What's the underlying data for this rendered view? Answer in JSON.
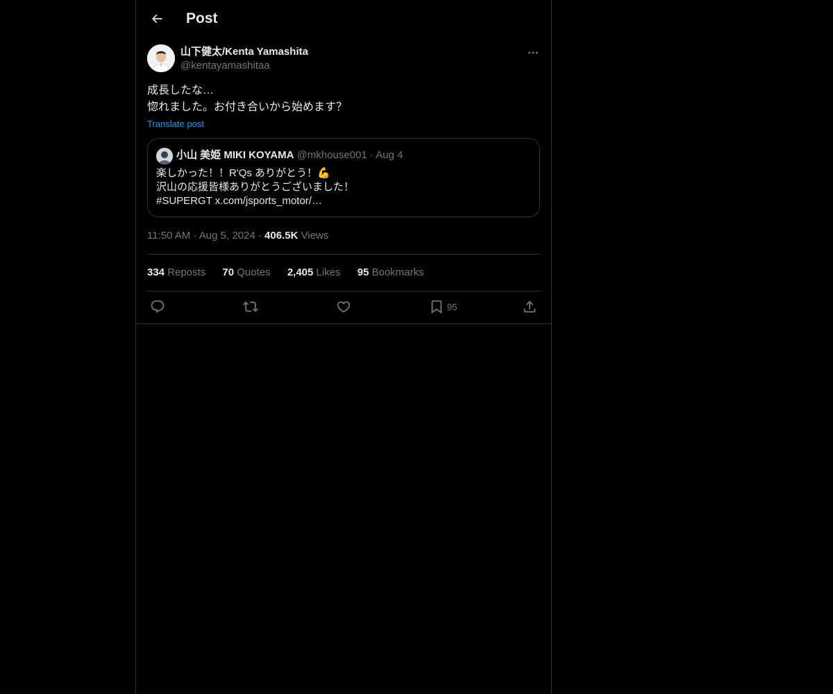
{
  "header": {
    "title": "Post",
    "back_icon": "arrow-left-icon"
  },
  "post": {
    "author_name": "山下健太/Kenta Yamashita",
    "author_handle": "@kentayamashitaa",
    "text": "成長したな…\n惚れました。お付き合いから始めます？",
    "translate_label": "Translate post",
    "timestamp": "11:50 AM",
    "date": "Aug 5, 2024",
    "views_count": "406.5K",
    "views_label": "Views"
  },
  "quote": {
    "author_name": "小山 美姫 MIKI KOYAMA",
    "author_handle": "@mkhouse001",
    "date": "Aug 4",
    "lines": [
      "楽しかった！！R'Qs ありがとう！💪",
      "沢山の応援皆様ありがとうございました！",
      "#SUPERGT x.com/jsports_motor/…"
    ]
  },
  "stats": [
    {
      "count": "334",
      "label": "Reposts"
    },
    {
      "count": "70",
      "label": "Quotes"
    },
    {
      "count": "2,405",
      "label": "Likes"
    },
    {
      "count": "95",
      "label": "Bookmarks"
    }
  ],
  "actions": {
    "reply_icon": "reply-icon",
    "repost_icon": "repost-icon",
    "like_icon": "heart-icon",
    "bookmark_icon": "bookmark-icon",
    "bookmark_count": "95",
    "share_icon": "share-icon"
  },
  "colors": {
    "background": "#000000",
    "text": "#e7e9ea",
    "muted": "#71767b",
    "accent": "#1d9bf0",
    "border": "#2f3336"
  }
}
